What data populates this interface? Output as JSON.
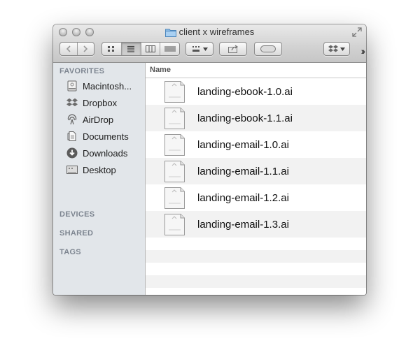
{
  "window": {
    "title": "client x wireframes"
  },
  "toolbar": {
    "nav": [
      "back-icon",
      "forward-icon"
    ],
    "views": [
      "icon-view",
      "list-view",
      "column-view",
      "coverflow-view"
    ],
    "active_view": "list-view",
    "arrange": "arrange-icon",
    "share": "share-icon",
    "tags": "tag-icon",
    "dropbox": "dropbox-icon"
  },
  "sidebar": {
    "favorites_label": "FAVORITES",
    "items": [
      {
        "label": "Macintosh...",
        "icon": "hard-drive-icon"
      },
      {
        "label": "Dropbox",
        "icon": "dropbox-icon"
      },
      {
        "label": "AirDrop",
        "icon": "airdrop-icon"
      },
      {
        "label": "Documents",
        "icon": "documents-icon"
      },
      {
        "label": "Downloads",
        "icon": "downloads-icon"
      },
      {
        "label": "Desktop",
        "icon": "desktop-icon"
      }
    ],
    "devices_label": "DEVICES",
    "shared_label": "SHARED",
    "tags_label": "TAGS"
  },
  "list": {
    "column_name": "Name",
    "files": [
      {
        "name": "landing-ebook-1.0.ai"
      },
      {
        "name": "landing-ebook-1.1.ai"
      },
      {
        "name": "landing-email-1.0.ai"
      },
      {
        "name": "landing-email-1.1.ai"
      },
      {
        "name": "landing-email-1.2.ai"
      },
      {
        "name": "landing-email-1.3.ai"
      }
    ]
  }
}
